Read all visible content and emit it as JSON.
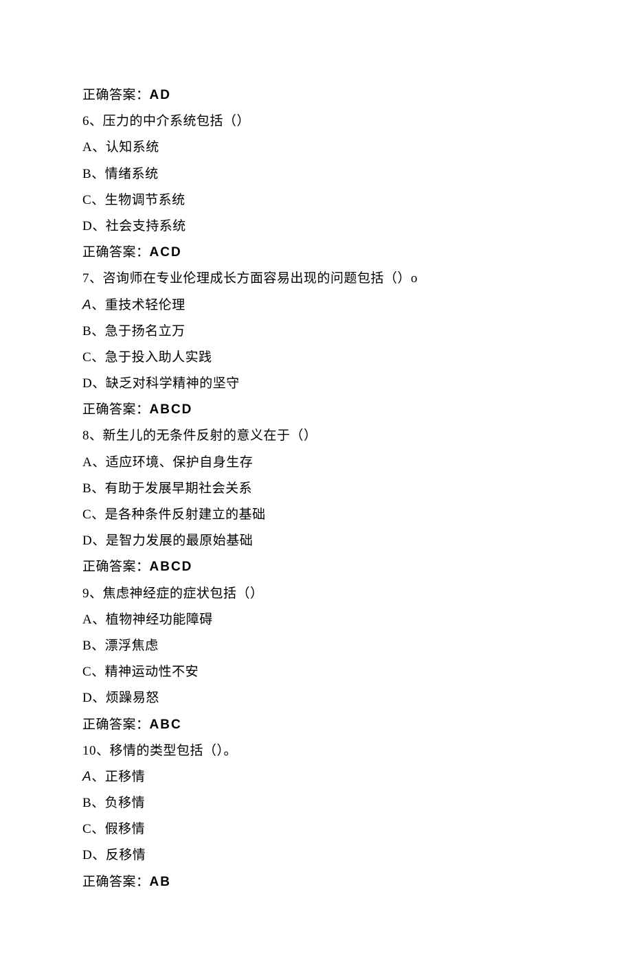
{
  "lines": {
    "l1_label": "正确答案：",
    "l1_value": "AD",
    "l2": "6、压力的中介系统包括（）",
    "l3": "A、认知系统",
    "l4": "B、情绪系统",
    "l5": "C、生物调节系统",
    "l6": "D、社会支持系统",
    "l7_label": "正确答案：",
    "l7_value": "ACD",
    "l8": "7、咨询师在专业伦理成长方面容易出现的问题包括（）o",
    "l9_a": "A",
    "l9_rest": "、重技术轻伦理",
    "l10": "B、急于扬名立万",
    "l11": "C、急于投入助人实践",
    "l12": "D、缺乏对科学精神的坚守",
    "l13_label": "正确答案：",
    "l13_value": "ABCD",
    "l14": "8、新生儿的无条件反射的意义在于（）",
    "l15": "A、适应环境、保护自身生存",
    "l16": "B、有助于发展早期社会关系",
    "l17": "C、是各种条件反射建立的基础",
    "l18": "D、是智力发展的最原始基础",
    "l19_label": "正确答案：",
    "l19_value": "ABCD",
    "l20": "9、焦虑神经症的症状包括（）",
    "l21": "A、植物神经功能障碍",
    "l22": "B、漂浮焦虑",
    "l23": "C、精神运动性不安",
    "l24": "D、烦躁易怒",
    "l25_label": "正确答案：",
    "l25_value": "ABC",
    "l26": "10、移情的类型包括（）。",
    "l27_a": "A",
    "l27_rest": "、正移情",
    "l28": "B、负移情",
    "l29": "C、假移情",
    "l30": "D、反移情",
    "l31_label": "正确答案：",
    "l31_value": "AB"
  }
}
